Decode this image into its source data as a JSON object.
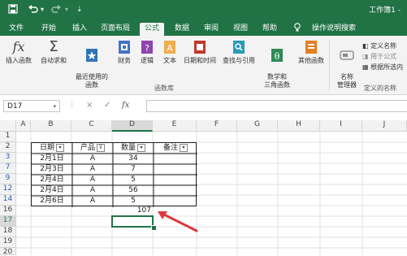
{
  "titlebar": {
    "save_icon": "save-icon",
    "undo_icon": "undo-icon",
    "redo_icon": "redo-icon",
    "workbook_title": "工作簿1 -"
  },
  "tabs": [
    "文件",
    "开始",
    "插入",
    "页面布局",
    "公式",
    "数据",
    "审阅",
    "视图",
    "帮助",
    "操作说明搜索"
  ],
  "active_tab": "公式",
  "ribbon": {
    "function_library": {
      "buttons": [
        "插入函数",
        "自动求和",
        "最近使用的\n函数",
        "财务",
        "逻辑",
        "文本",
        "日期和时间",
        "查找与引用",
        "数学和\n三角函数",
        "其他函数"
      ],
      "label": "函数库"
    },
    "defined_names": {
      "name_manager": "名称\n管理器",
      "define_name": "定义名称",
      "use_in_formula": "用于公式",
      "create_from_selection": "根据所选内",
      "label": "定义的名称"
    }
  },
  "formula_bar": {
    "name_box": "D17",
    "fx": "fx",
    "cancel": "×",
    "enter": "✓",
    "content": ""
  },
  "columns": [
    "A",
    "B",
    "C",
    "D",
    "E",
    "F",
    "G",
    "H",
    "I",
    "J"
  ],
  "rows": [
    "1",
    "2",
    "3",
    "7",
    "9",
    "12",
    "14",
    "16",
    "17",
    "18",
    "19",
    "20"
  ],
  "table": {
    "headers": [
      "日期",
      "产品",
      "数量",
      "备注"
    ],
    "rows": [
      [
        "2月1日",
        "A",
        "34",
        ""
      ],
      [
        "2月3日",
        "A",
        "7",
        ""
      ],
      [
        "2月4日",
        "A",
        "5",
        ""
      ],
      [
        "2月4日",
        "A",
        "56",
        ""
      ],
      [
        "2月6日",
        "A",
        "5",
        ""
      ]
    ],
    "sum_value": "107"
  },
  "colors": {
    "excel_green": "#217346",
    "arrow_red": "#e0393e",
    "row_number_blue": "#2f5fb3"
  }
}
